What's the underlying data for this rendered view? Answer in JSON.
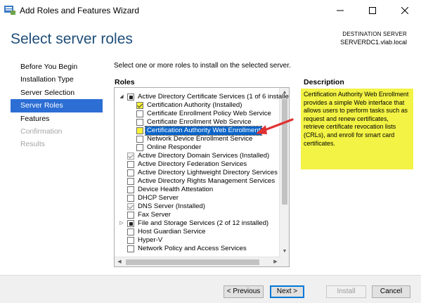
{
  "window": {
    "title": "Add Roles and Features Wizard",
    "app_icon": "server-manager-icon"
  },
  "header": {
    "page_title": "Select server roles",
    "destination_label": "DESTINATION SERVER",
    "destination_value": "SERVERDC1.vlab.local"
  },
  "nav": {
    "items": [
      {
        "label": "Before You Begin",
        "state": "normal"
      },
      {
        "label": "Installation Type",
        "state": "normal"
      },
      {
        "label": "Server Selection",
        "state": "normal"
      },
      {
        "label": "Server Roles",
        "state": "active"
      },
      {
        "label": "Features",
        "state": "normal"
      },
      {
        "label": "Confirmation",
        "state": "disabled"
      },
      {
        "label": "Results",
        "state": "disabled"
      }
    ]
  },
  "main": {
    "instruction": "Select one or more roles to install on the selected server.",
    "roles_heading": "Roles",
    "description_heading": "Description",
    "description_text": "Certification Authority Web Enrollment provides a simple Web interface that allows users to perform tasks such as request and renew certificates, retrieve certificate revocation lists (CRLs), and enroll for smart card certificates."
  },
  "roles": [
    {
      "label": "Active Directory Certificate Services (1 of 6 installe",
      "level": 0,
      "expander": "collapse",
      "check": "partial"
    },
    {
      "label": "Certification Authority (Installed)",
      "level": 1,
      "expander": "",
      "check": "checked-yellow"
    },
    {
      "label": "Certificate Enrollment Policy Web Service",
      "level": 1,
      "expander": "",
      "check": "unchecked"
    },
    {
      "label": "Certificate Enrollment Web Service",
      "level": 1,
      "expander": "",
      "check": "unchecked"
    },
    {
      "label": "Certification Authority Web Enrollment",
      "level": 1,
      "expander": "",
      "check": "unchecked-yellow",
      "selected": true
    },
    {
      "label": "Network Device Enrollment Service",
      "level": 1,
      "expander": "",
      "check": "unchecked"
    },
    {
      "label": "Online Responder",
      "level": 1,
      "expander": "",
      "check": "unchecked"
    },
    {
      "label": "Active Directory Domain Services (Installed)",
      "level": 0,
      "expander": "",
      "check": "checked-gray"
    },
    {
      "label": "Active Directory Federation Services",
      "level": 0,
      "expander": "",
      "check": "unchecked"
    },
    {
      "label": "Active Directory Lightweight Directory Services",
      "level": 0,
      "expander": "",
      "check": "unchecked"
    },
    {
      "label": "Active Directory Rights Management Services",
      "level": 0,
      "expander": "",
      "check": "unchecked"
    },
    {
      "label": "Device Health Attestation",
      "level": 0,
      "expander": "",
      "check": "unchecked"
    },
    {
      "label": "DHCP Server",
      "level": 0,
      "expander": "",
      "check": "unchecked"
    },
    {
      "label": "DNS Server (Installed)",
      "level": 0,
      "expander": "",
      "check": "checked-gray"
    },
    {
      "label": "Fax Server",
      "level": 0,
      "expander": "",
      "check": "unchecked"
    },
    {
      "label": "File and Storage Services (2 of 12 installed)",
      "level": 0,
      "expander": "expand",
      "check": "partial"
    },
    {
      "label": "Host Guardian Service",
      "level": 0,
      "expander": "",
      "check": "unchecked"
    },
    {
      "label": "Hyper-V",
      "level": 0,
      "expander": "",
      "check": "unchecked"
    },
    {
      "label": "Network Policy and Access Services",
      "level": 0,
      "expander": "",
      "check": "unchecked"
    }
  ],
  "footer": {
    "previous_label": "< Previous",
    "next_label": "Next >",
    "install_label": "Install",
    "cancel_label": "Cancel"
  },
  "colors": {
    "accent": "#2c6ed4",
    "title": "#1f4e79",
    "highlight_yellow": "#f3f345",
    "annotation_arrow": "#e03131"
  }
}
